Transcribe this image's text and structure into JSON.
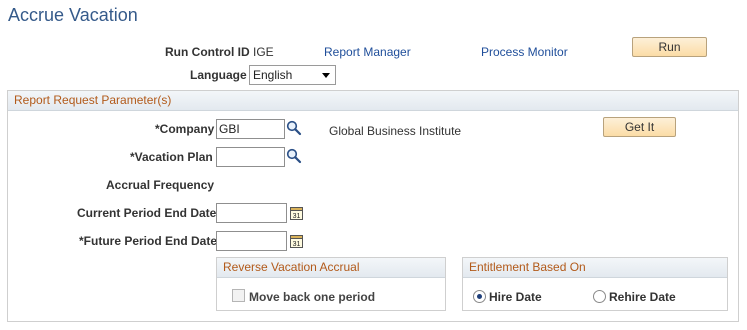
{
  "page": {
    "title": "Accrue Vacation"
  },
  "run_control": {
    "label": "Run Control ID",
    "value": "IGE",
    "report_manager": "Report Manager",
    "process_monitor": "Process Monitor",
    "run_button": "Run",
    "language_label": "Language",
    "language_value": "English"
  },
  "parameters": {
    "header": "Report Request Parameter(s)",
    "company_label": "*Company",
    "company_value": "GBI",
    "company_description": "Global Business Institute",
    "get_it_button": "Get It",
    "vacation_plan_label": "*Vacation Plan",
    "vacation_plan_value": "",
    "accrual_frequency_label": "Accrual Frequency",
    "current_period_label": "Current Period End Date",
    "current_period_value": "",
    "future_period_label": "*Future Period End Date",
    "future_period_value": "",
    "calendar_day": "31"
  },
  "reverse_accrual": {
    "header": "Reverse Vacation Accrual",
    "checkbox_label": "Move back one period",
    "checked": false
  },
  "entitlement": {
    "header": "Entitlement Based On",
    "options": [
      "Hire Date",
      "Rehire Date"
    ],
    "selected": "Hire Date"
  },
  "colors": {
    "title": "#355a8a",
    "link": "#1f4e9a",
    "section_header_text": "#b25a1a",
    "button_bg": "#fbdca6"
  }
}
